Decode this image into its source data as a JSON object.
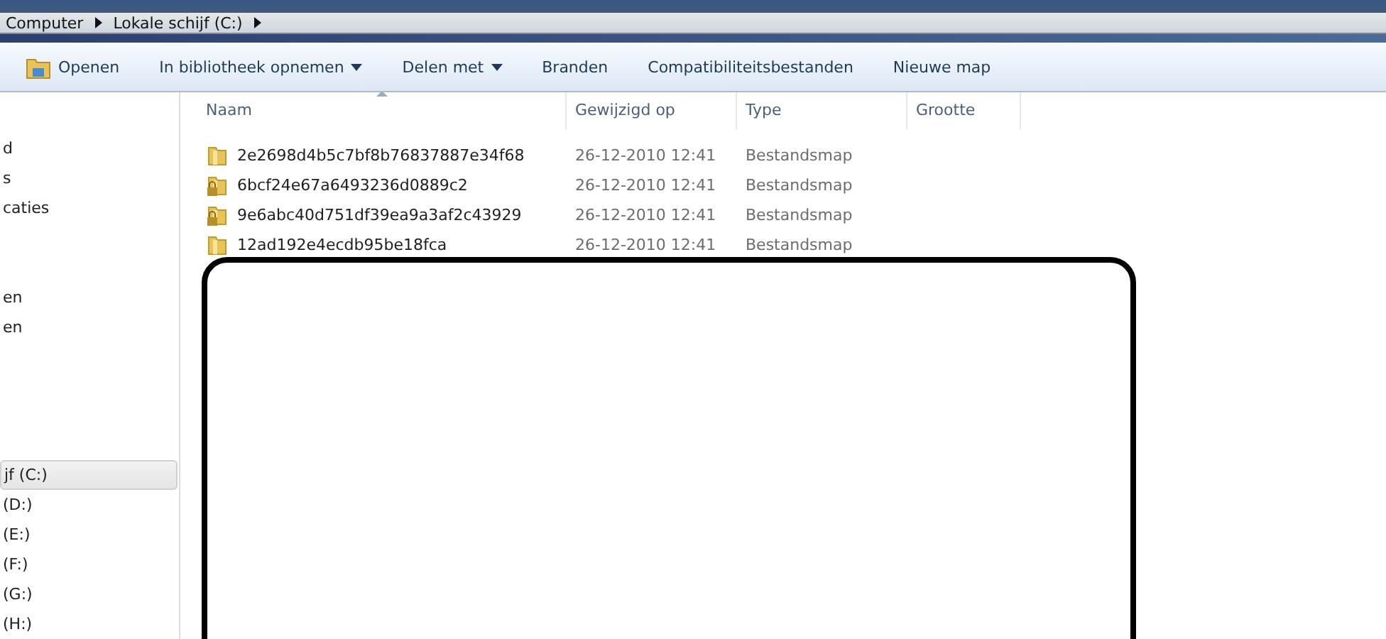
{
  "address_bar": {
    "crumbs": [
      "Computer",
      "Lokale schijf (C:)"
    ]
  },
  "toolbar": {
    "buttons": [
      {
        "label": "Openen",
        "kind": "icon"
      },
      {
        "label": "In bibliotheek opnemen",
        "kind": "dropdown"
      },
      {
        "label": "Delen met",
        "kind": "dropdown"
      },
      {
        "label": "Branden",
        "kind": "plain"
      },
      {
        "label": "Compatibiliteitsbestanden",
        "kind": "plain"
      },
      {
        "label": "Nieuwe map",
        "kind": "plain"
      }
    ]
  },
  "sidebar": {
    "groups": [
      {
        "items": [
          {
            "label": "d",
            "selected": false
          },
          {
            "label": "s",
            "selected": false
          },
          {
            "label": "caties",
            "selected": false
          }
        ]
      },
      {
        "items": [
          {
            "label": "en",
            "selected": false
          },
          {
            "label": "en",
            "selected": false
          }
        ]
      },
      {
        "items": [
          {
            "label": "jf (C:)",
            "selected": true
          },
          {
            "label": "(D:)",
            "selected": false
          },
          {
            "label": "(E:)",
            "selected": false
          },
          {
            "label": "(F:)",
            "selected": false
          },
          {
            "label": "(G:)",
            "selected": false
          },
          {
            "label": "(H:)",
            "selected": false
          }
        ]
      }
    ]
  },
  "table": {
    "columns": [
      "Naam",
      "Gewijzigd op",
      "Type",
      "Grootte"
    ],
    "rows": [
      {
        "name": "2e2698d4b5c7bf8b76837887e34f68",
        "modified": "26-12-2010 12:41",
        "type": "Bestandsmap",
        "locked": false
      },
      {
        "name": "6bcf24e67a6493236d0889c2",
        "modified": "26-12-2010 12:41",
        "type": "Bestandsmap",
        "locked": true
      },
      {
        "name": "9e6abc40d751df39ea9a3af2c43929",
        "modified": "26-12-2010 12:41",
        "type": "Bestandsmap",
        "locked": true
      },
      {
        "name": "12ad192e4ecdb95be18fca",
        "modified": "26-12-2010 12:41",
        "type": "Bestandsmap",
        "locked": false
      }
    ]
  }
}
